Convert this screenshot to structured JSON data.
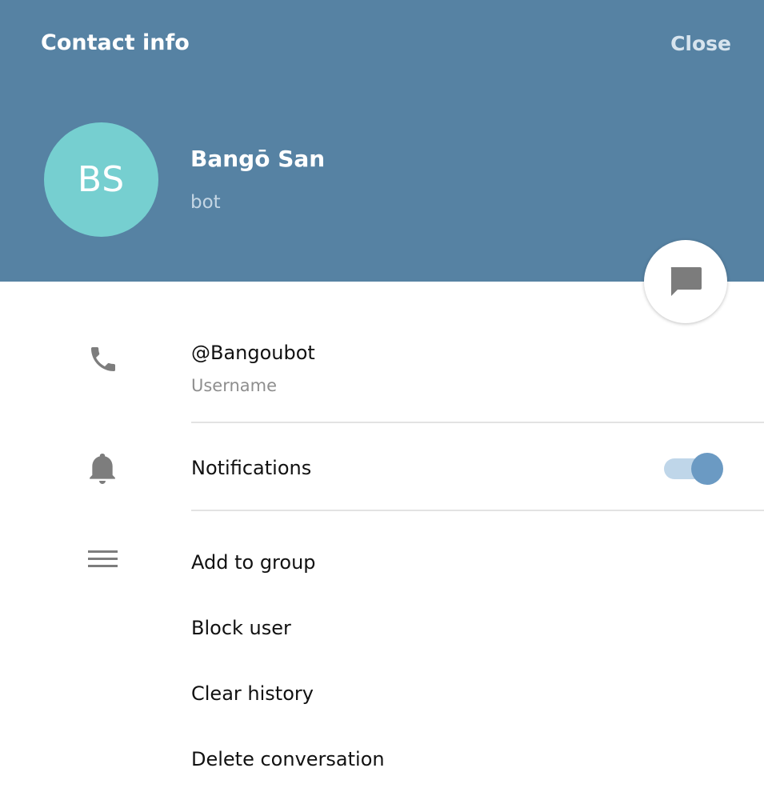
{
  "header": {
    "title": "Contact info",
    "close_label": "Close",
    "background": "#5682a3"
  },
  "profile": {
    "initials": "BS",
    "avatar_color": "#76cfd0",
    "name": "Bangō San",
    "status": "bot"
  },
  "fab": {
    "icon": "message-icon"
  },
  "username": {
    "icon": "phone-icon",
    "value": "@Bangoubot",
    "label": "Username"
  },
  "notifications": {
    "icon": "bell-icon",
    "label": "Notifications",
    "enabled": true,
    "toggle_color": "#6b9ac3"
  },
  "actions": {
    "icon": "menu-icon",
    "items": [
      {
        "label": "Add to group"
      },
      {
        "label": "Block user"
      },
      {
        "label": "Clear history"
      },
      {
        "label": "Delete conversation"
      }
    ]
  }
}
